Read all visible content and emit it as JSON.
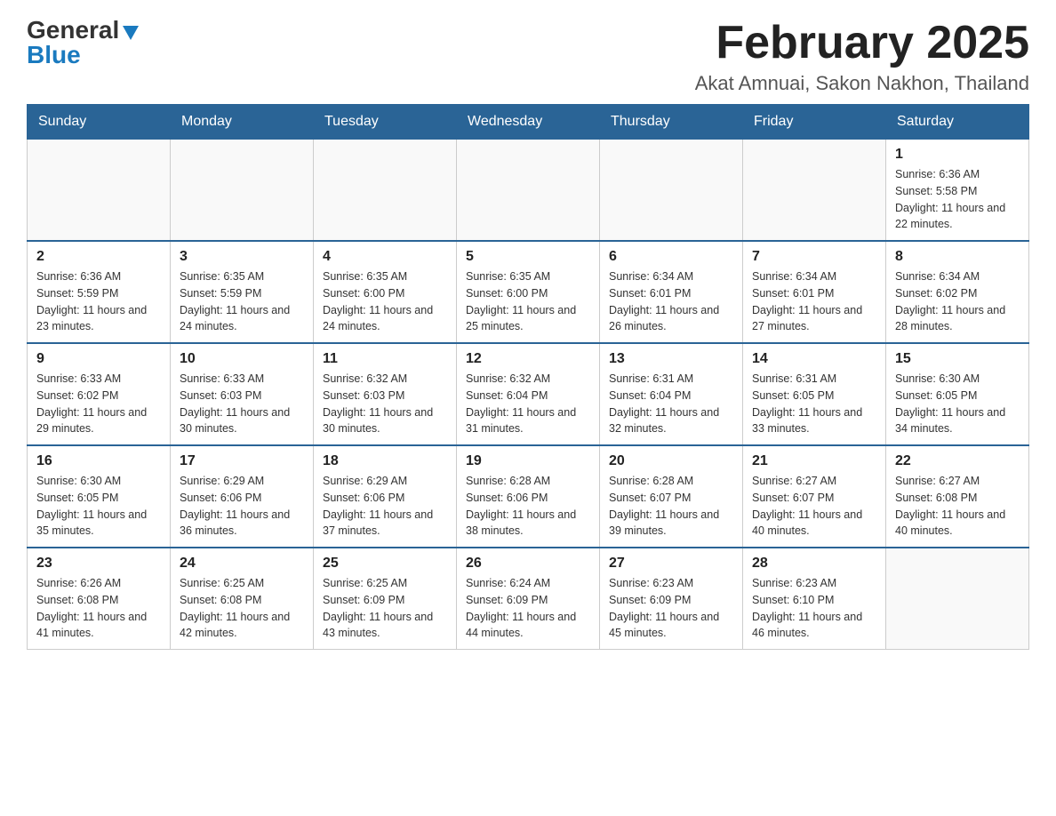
{
  "header": {
    "logo_general": "General",
    "logo_blue": "Blue",
    "month_year": "February 2025",
    "location": "Akat Amnuai, Sakon Nakhon, Thailand"
  },
  "days_of_week": [
    "Sunday",
    "Monday",
    "Tuesday",
    "Wednesday",
    "Thursday",
    "Friday",
    "Saturday"
  ],
  "weeks": [
    {
      "days": [
        {
          "number": "",
          "info": ""
        },
        {
          "number": "",
          "info": ""
        },
        {
          "number": "",
          "info": ""
        },
        {
          "number": "",
          "info": ""
        },
        {
          "number": "",
          "info": ""
        },
        {
          "number": "",
          "info": ""
        },
        {
          "number": "1",
          "info": "Sunrise: 6:36 AM\nSunset: 5:58 PM\nDaylight: 11 hours and 22 minutes."
        }
      ]
    },
    {
      "days": [
        {
          "number": "2",
          "info": "Sunrise: 6:36 AM\nSunset: 5:59 PM\nDaylight: 11 hours and 23 minutes."
        },
        {
          "number": "3",
          "info": "Sunrise: 6:35 AM\nSunset: 5:59 PM\nDaylight: 11 hours and 24 minutes."
        },
        {
          "number": "4",
          "info": "Sunrise: 6:35 AM\nSunset: 6:00 PM\nDaylight: 11 hours and 24 minutes."
        },
        {
          "number": "5",
          "info": "Sunrise: 6:35 AM\nSunset: 6:00 PM\nDaylight: 11 hours and 25 minutes."
        },
        {
          "number": "6",
          "info": "Sunrise: 6:34 AM\nSunset: 6:01 PM\nDaylight: 11 hours and 26 minutes."
        },
        {
          "number": "7",
          "info": "Sunrise: 6:34 AM\nSunset: 6:01 PM\nDaylight: 11 hours and 27 minutes."
        },
        {
          "number": "8",
          "info": "Sunrise: 6:34 AM\nSunset: 6:02 PM\nDaylight: 11 hours and 28 minutes."
        }
      ]
    },
    {
      "days": [
        {
          "number": "9",
          "info": "Sunrise: 6:33 AM\nSunset: 6:02 PM\nDaylight: 11 hours and 29 minutes."
        },
        {
          "number": "10",
          "info": "Sunrise: 6:33 AM\nSunset: 6:03 PM\nDaylight: 11 hours and 30 minutes."
        },
        {
          "number": "11",
          "info": "Sunrise: 6:32 AM\nSunset: 6:03 PM\nDaylight: 11 hours and 30 minutes."
        },
        {
          "number": "12",
          "info": "Sunrise: 6:32 AM\nSunset: 6:04 PM\nDaylight: 11 hours and 31 minutes."
        },
        {
          "number": "13",
          "info": "Sunrise: 6:31 AM\nSunset: 6:04 PM\nDaylight: 11 hours and 32 minutes."
        },
        {
          "number": "14",
          "info": "Sunrise: 6:31 AM\nSunset: 6:05 PM\nDaylight: 11 hours and 33 minutes."
        },
        {
          "number": "15",
          "info": "Sunrise: 6:30 AM\nSunset: 6:05 PM\nDaylight: 11 hours and 34 minutes."
        }
      ]
    },
    {
      "days": [
        {
          "number": "16",
          "info": "Sunrise: 6:30 AM\nSunset: 6:05 PM\nDaylight: 11 hours and 35 minutes."
        },
        {
          "number": "17",
          "info": "Sunrise: 6:29 AM\nSunset: 6:06 PM\nDaylight: 11 hours and 36 minutes."
        },
        {
          "number": "18",
          "info": "Sunrise: 6:29 AM\nSunset: 6:06 PM\nDaylight: 11 hours and 37 minutes."
        },
        {
          "number": "19",
          "info": "Sunrise: 6:28 AM\nSunset: 6:06 PM\nDaylight: 11 hours and 38 minutes."
        },
        {
          "number": "20",
          "info": "Sunrise: 6:28 AM\nSunset: 6:07 PM\nDaylight: 11 hours and 39 minutes."
        },
        {
          "number": "21",
          "info": "Sunrise: 6:27 AM\nSunset: 6:07 PM\nDaylight: 11 hours and 40 minutes."
        },
        {
          "number": "22",
          "info": "Sunrise: 6:27 AM\nSunset: 6:08 PM\nDaylight: 11 hours and 40 minutes."
        }
      ]
    },
    {
      "days": [
        {
          "number": "23",
          "info": "Sunrise: 6:26 AM\nSunset: 6:08 PM\nDaylight: 11 hours and 41 minutes."
        },
        {
          "number": "24",
          "info": "Sunrise: 6:25 AM\nSunset: 6:08 PM\nDaylight: 11 hours and 42 minutes."
        },
        {
          "number": "25",
          "info": "Sunrise: 6:25 AM\nSunset: 6:09 PM\nDaylight: 11 hours and 43 minutes."
        },
        {
          "number": "26",
          "info": "Sunrise: 6:24 AM\nSunset: 6:09 PM\nDaylight: 11 hours and 44 minutes."
        },
        {
          "number": "27",
          "info": "Sunrise: 6:23 AM\nSunset: 6:09 PM\nDaylight: 11 hours and 45 minutes."
        },
        {
          "number": "28",
          "info": "Sunrise: 6:23 AM\nSunset: 6:10 PM\nDaylight: 11 hours and 46 minutes."
        },
        {
          "number": "",
          "info": ""
        }
      ]
    }
  ]
}
